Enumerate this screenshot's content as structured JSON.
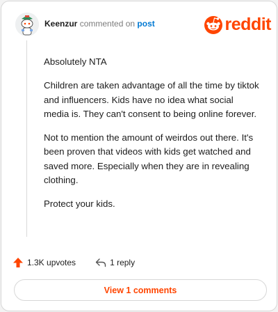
{
  "comment": {
    "username": "Keenzur",
    "action_text": "commented on",
    "post_link": "post",
    "paragraphs": [
      "Absolutely NTA",
      "Children are taken advantage of all the time by tiktok and influencers. Kids have no idea what social media is. They can't consent to being online forever.",
      "Not to mention the amount of weirdos out there. It's been proven that videos with kids get watched and saved more. Especially when they are in revealing clothing.",
      "Protect your kids."
    ],
    "upvotes": "1.3K upvotes",
    "replies": "1 reply",
    "view_button": "View 1 comments"
  },
  "brand": {
    "wordmark": "reddit",
    "accent": "#ff4500"
  },
  "icons": {
    "avatar": "snoo-avatar",
    "logo": "reddit-logo-icon",
    "upvote": "upvote-arrow-icon",
    "reply": "reply-arrow-icon"
  }
}
